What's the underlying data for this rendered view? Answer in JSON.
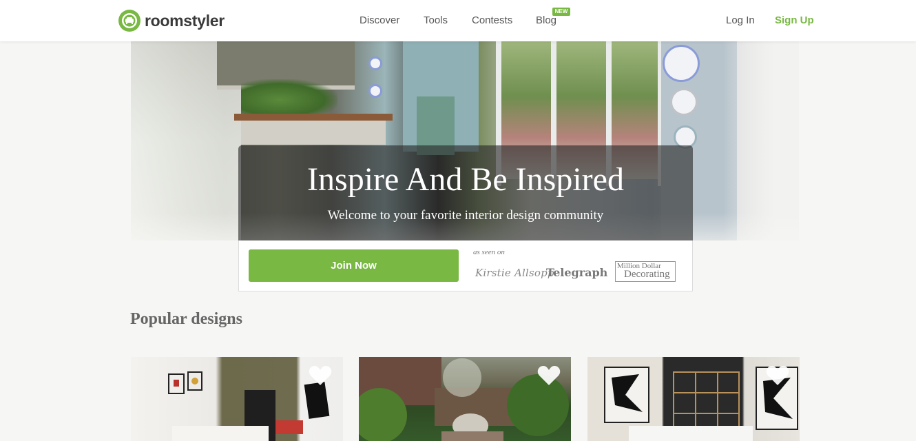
{
  "header": {
    "logo_text": "roomstyler",
    "nav": [
      {
        "label": "Discover"
      },
      {
        "label": "Tools"
      },
      {
        "label": "Contests"
      },
      {
        "label": "Blog",
        "badge": "NEW"
      }
    ],
    "login_label": "Log In",
    "signup_label": "Sign Up"
  },
  "hero": {
    "title": "Inspire And Be Inspired",
    "subtitle": "Welcome to your favorite interior design community",
    "cta_label": "Join Now",
    "as_seen_on": "as seen on",
    "press": [
      {
        "name": "Kirstie Allsopp"
      },
      {
        "name": "Telegraph"
      },
      {
        "name": "Million Dollar Decorating",
        "line1": "Million Dollar",
        "line2": "Decorating"
      }
    ]
  },
  "popular": {
    "title": "Popular designs",
    "cards": [
      {
        "icon": "heart-icon"
      },
      {
        "icon": "heart-icon"
      },
      {
        "icon": "heart-icon"
      }
    ]
  },
  "colors": {
    "brand_green": "#78b843",
    "text_dark": "#3a3a3a",
    "text_muted": "#555555"
  }
}
